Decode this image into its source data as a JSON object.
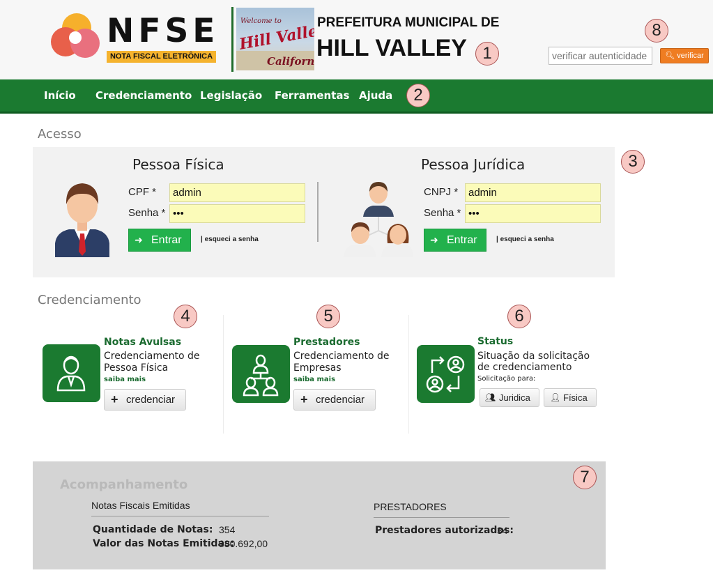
{
  "header": {
    "logo_text": "NFSE",
    "logo_tagline": "NOTA FISCAL ELETRÔNICA",
    "city_pre": "PREFEITURA MUNICIPAL DE",
    "city_name": "HILL VALLEY",
    "city_image_text": {
      "line1": "Welcome to",
      "line2": "Hill Valley",
      "line3": "California"
    },
    "auth_placeholder": "verificar autenticidade",
    "auth_button": "verificar",
    "auth_button_icon": "search-icon"
  },
  "nav": {
    "items": [
      "Início",
      "Credenciamento",
      "Legislação",
      "Ferramentas",
      "Ajuda"
    ]
  },
  "acesso": {
    "title": "Acesso",
    "fisica": {
      "title": "Pessoa Física",
      "id_label": "CPF *",
      "id_value": "admin",
      "password_label": "Senha *",
      "password_value": "•••",
      "button": "Entrar",
      "forgot": "| esqueci a senha"
    },
    "juridica": {
      "title": "Pessoa Jurídica",
      "id_label": "CNPJ *",
      "id_value": "admin",
      "password_label": "Senha *",
      "password_value": "•••",
      "button": "Entrar",
      "forgot": "| esqueci a senha"
    }
  },
  "credenciamento": {
    "title": "Credenciamento",
    "notas_avulsas": {
      "title": "Notas Avulsas",
      "desc_line1": "Credenciamento de",
      "desc_line2": "Pessoa Física",
      "more": "saiba mais",
      "button": "credenciar"
    },
    "prestadores": {
      "title": "Prestadores",
      "desc_line1": "Credenciamento de",
      "desc_line2": "Empresas",
      "more": "saiba mais",
      "button": "credenciar"
    },
    "status": {
      "title": "Status",
      "desc_line1": "Situação da solicitação",
      "desc_line2": "de credenciamento",
      "sub": "Solicitação para:",
      "button_juridica": "Juridica",
      "button_fisica": "Física"
    }
  },
  "acompanhamento": {
    "title": "Acompanhamento",
    "notas_heading": "Notas Fiscais Emitidas",
    "qtd_label": "Quantidade de Notas:",
    "qtd_value": "354",
    "valor_label": "Valor das Notas Emitidas:",
    "valor_value": "980.692,00",
    "prestadores_heading": "PRESTADORES",
    "autorizados_label": "Prestadores autorizados:",
    "autorizados_value": "34"
  },
  "markers": [
    "1",
    "2",
    "3",
    "4",
    "5",
    "6",
    "7",
    "8"
  ],
  "colors": {
    "brand_green": "#1b7a30",
    "button_green": "#22b14c",
    "accent_orange": "#ef7d22",
    "input_yellow": "#fbfbb9",
    "marker_pink": "#f8c9c4"
  }
}
